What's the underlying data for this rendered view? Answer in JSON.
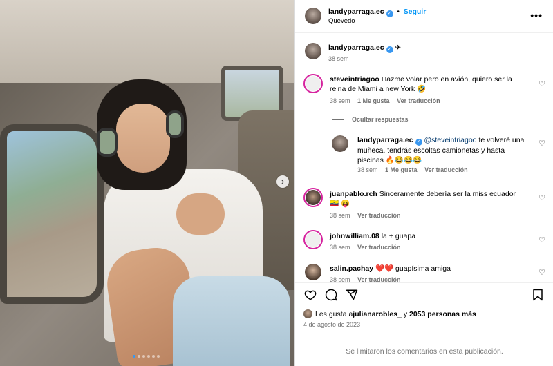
{
  "header": {
    "username": "landyparraga.ec",
    "follow_label": "Seguir",
    "location": "Quevedo",
    "more_label": "•••"
  },
  "caption": {
    "username": "landyparraga.ec",
    "text": "✈",
    "time": "38 sem"
  },
  "comments": [
    {
      "username": "steveintriagoo",
      "text": "Hazme volar pero en avión, quiero ser la reina de Miami a new York 🤣",
      "time": "38 sem",
      "likes": "1 Me gusta",
      "translate": "Ver traducción"
    },
    {
      "username": "juanpablo.rch",
      "text": "Sinceramente debería ser la miss ecuador 🇪🇨 😝",
      "time": "38 sem",
      "translate": "Ver traducción"
    },
    {
      "username": "johnwilliam.08",
      "text": "la + guapa",
      "time": "38 sem",
      "translate": "Ver traducción"
    },
    {
      "username": "salin.pachay",
      "text": "❤️❤️ guapísima amiga",
      "time": "38 sem",
      "translate": "Ver traducción"
    }
  ],
  "hide_replies_label": "Ocultar respuestas",
  "reply": {
    "username": "landyparraga.ec",
    "mention": "@steveintriagoo",
    "text": "te volveré una muñeca, tendrás escoltas camionetas y hasta piscinas 🔥😂😂😂",
    "time": "38 sem",
    "likes": "1 Me gusta",
    "translate": "Ver traducción"
  },
  "likes": {
    "prefix": "Les gusta a ",
    "user": "julianarobles_",
    "middle": " y ",
    "count": "2053 personas más"
  },
  "date": "4 de agosto de 2023",
  "footer_text": "Se limitaron los comentarios en esta publicación.",
  "carousel": {
    "slides": 6,
    "active_index": 0
  }
}
